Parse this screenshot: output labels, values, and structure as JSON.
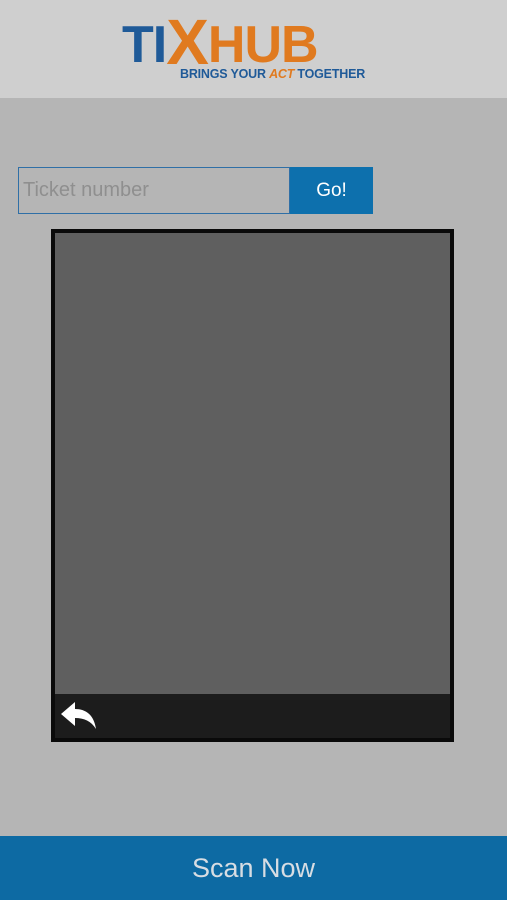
{
  "header": {
    "logo": {
      "word_ti": "TI",
      "word_x": "X",
      "word_hub": "HUB",
      "tagline_before": "BRINGS YOUR ",
      "tagline_act": "ACT",
      "tagline_after": " TOGETHER"
    }
  },
  "search": {
    "placeholder": "Ticket number",
    "value": "",
    "go_label": "Go!"
  },
  "scanner": {
    "back_icon": "reply-arrow-icon"
  },
  "footer": {
    "scan_label": "Scan Now"
  },
  "colors": {
    "brand_blue": "#1f5a98",
    "brand_orange": "#e07a1f",
    "button_blue": "#0d70ad",
    "footer_blue": "#0d6aa3",
    "background": "#b5b5b5",
    "header_bg": "#cfcfcf",
    "camera_preview": "#5f5f5f",
    "camera_toolbar": "#1c1c1c"
  }
}
